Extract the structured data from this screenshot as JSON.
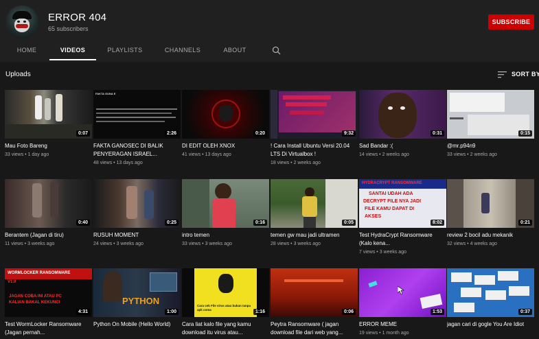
{
  "channel": {
    "name": "ERROR 404",
    "subscribers": "65 subscribers",
    "subscribe_label": "SUBSCRIBE"
  },
  "tabs": [
    {
      "label": "HOME"
    },
    {
      "label": "VIDEOS"
    },
    {
      "label": "PLAYLISTS"
    },
    {
      "label": "CHANNELS"
    },
    {
      "label": "ABOUT"
    }
  ],
  "section": {
    "title": "Uploads",
    "sort_label": "SORT BY"
  },
  "videos": [
    {
      "title": "Mau Foto Bareng",
      "views": "33 views",
      "ago": "1 day ago",
      "duration": "0:07"
    },
    {
      "title": "FAKTA GANOSEC DI BALIK PENYERAGAN ISRAEL...",
      "views": "48 views",
      "ago": "13 days ago",
      "duration": "2:26",
      "thumb_text": "FAKTA GUNA E"
    },
    {
      "title": "DI EDIT OLEH XNOX",
      "views": "41 views",
      "ago": "13 days ago",
      "duration": "0:20"
    },
    {
      "title": "! Cara Install Ubuntu Versi 20.04 LTS Di Virtualbox !",
      "views": "18 views",
      "ago": "2 weeks ago",
      "duration": "9:32"
    },
    {
      "title": "Sad Bandar :(",
      "views": "14 views",
      "ago": "2 weeks ago",
      "duration": "0:31"
    },
    {
      "title": "@mr.p94n9",
      "views": "33 views",
      "ago": "2 weeks ago",
      "duration": "0:15"
    },
    {
      "title": "Berantem (Jagan di tiru)",
      "views": "11 views",
      "ago": "3 weeks ago",
      "duration": "0:40"
    },
    {
      "title": "RUSUH MOMENT",
      "views": "24 views",
      "ago": "3 weeks ago",
      "duration": "0:25"
    },
    {
      "title": "intro temen",
      "views": "33 views",
      "ago": "3 weeks ago",
      "duration": "0:16"
    },
    {
      "title": "temen gw mau jadi ultramen",
      "views": "28 views",
      "ago": "3 weeks ago",
      "duration": "0:05"
    },
    {
      "title": "Test HydraCrypt Ransomware (Kalo kena...",
      "views": "7 views",
      "ago": "3 weeks ago",
      "duration": "8:02",
      "thumb_text": [
        "HYDRACRYPT RANSOMWARE",
        "SANTAI UDAH ADA",
        "DECRYPT FILE NYA JADI",
        "FILE KAMU DAPAT DI",
        "AKSES"
      ]
    },
    {
      "title": "review 2 bocil adu mekanik",
      "views": "32 views",
      "ago": "4 weeks ago",
      "duration": "0:21"
    },
    {
      "title": "Test WormLocker Ransomware (Jagan pernah...",
      "views": "",
      "ago": "",
      "duration": "4:31",
      "thumb_text": [
        "WORMLOCKER RANSOMWARE",
        "V1.0",
        "JAGAN COBA INI ATAU PC",
        "KALIAN BAKAL KEKUNCI"
      ]
    },
    {
      "title": "Python On Mobile (Hello World)",
      "views": "",
      "ago": "",
      "duration": "1:00",
      "thumb_text": "PYTHON"
    },
    {
      "title": "Cara liat kalo file yang kamu download itu virus atau...",
      "views": "",
      "ago": "",
      "duration": "1:16",
      "thumb_text": "Cara cek File virus atau bukan tanpa apk coma"
    },
    {
      "title": "Peytra Ransomware ( jagan download file dari web yang...",
      "views": "",
      "ago": "",
      "duration": "0:06"
    },
    {
      "title": "ERROR MEME",
      "views": "19 views",
      "ago": "1 month ago",
      "duration": "1:53"
    },
    {
      "title": "jagan cari di gogle You Are Idiot",
      "views": "",
      "ago": "",
      "duration": "0:37"
    }
  ]
}
